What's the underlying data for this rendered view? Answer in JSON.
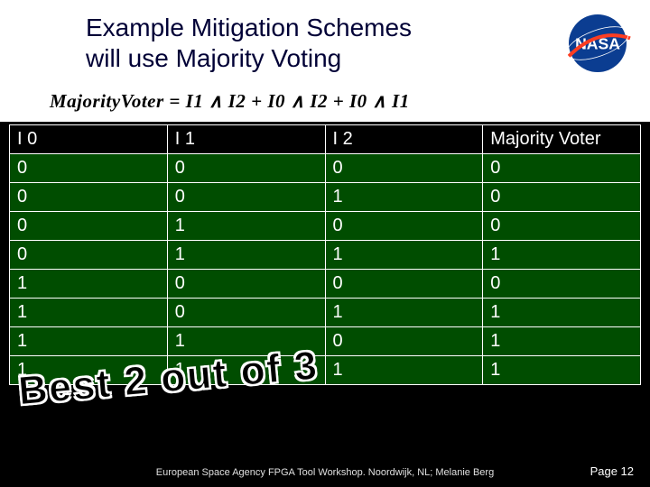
{
  "title_line1": "Example Mitigation Schemes",
  "title_line2": "will use Majority Voting",
  "formula": "MajorityVoter = I1 ∧ I2 + I0 ∧ I2 + I0 ∧ I1",
  "logo_text": "NASA",
  "table": {
    "headers": [
      "I 0",
      "I 1",
      "I 2",
      "Majority Voter"
    ],
    "rows": [
      [
        "0",
        "0",
        "0",
        "0"
      ],
      [
        "0",
        "0",
        "1",
        "0"
      ],
      [
        "0",
        "1",
        "0",
        "0"
      ],
      [
        "0",
        "1",
        "1",
        "1"
      ],
      [
        "1",
        "0",
        "0",
        "0"
      ],
      [
        "1",
        "0",
        "1",
        "1"
      ],
      [
        "1",
        "1",
        "0",
        "1"
      ],
      [
        "1",
        "1",
        "1",
        "1"
      ]
    ]
  },
  "overlay_text": "Best 2 out of 3",
  "footer": "European Space Agency FPGA Tool Workshop.  Noordwijk, NL; Melanie Berg",
  "page": "Page 12"
}
